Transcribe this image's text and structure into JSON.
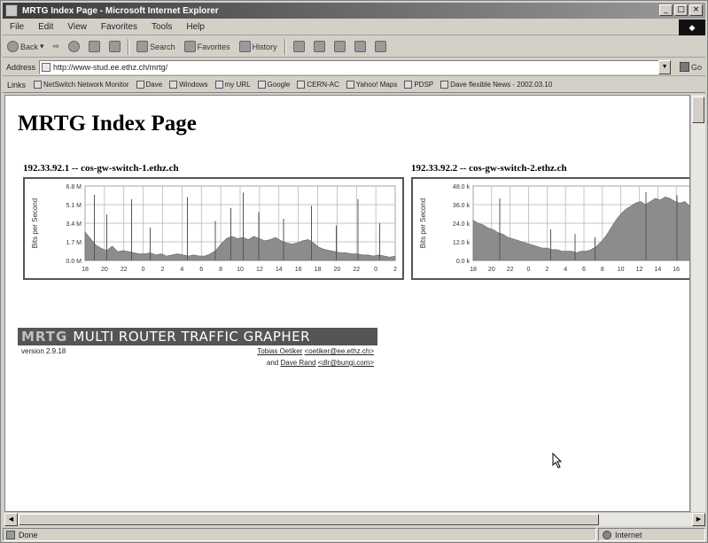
{
  "window": {
    "title": "MRTG Index Page - Microsoft Internet Explorer",
    "buttons": [
      "_",
      "□",
      "×"
    ]
  },
  "menu": {
    "items": [
      "File",
      "Edit",
      "View",
      "Favorites",
      "Tools",
      "Help"
    ]
  },
  "toolbar": {
    "back": "Back",
    "search": "Search",
    "favorites": "Favorites",
    "history": "History"
  },
  "address": {
    "label": "Address",
    "url": "http://www-stud.ee.ethz.ch/mrtg/",
    "go": "Go"
  },
  "links": {
    "label": "Links",
    "items": [
      "NetSwitch Network Monitor",
      "Dave",
      "Windows",
      "my URL",
      "Google",
      "CERN-AC",
      "Yahoo! Maps",
      "PDSP",
      "Dave flexible News - 2002.03.10"
    ]
  },
  "page": {
    "title": "MRTG Index Page"
  },
  "graphs": [
    {
      "caption": "192.33.92.1 -- cos-gw-switch-1.ethz.ch",
      "ylabel": "Bits per Second",
      "yticks": [
        "6.8 M",
        "5.1 M",
        "3.4 M",
        "1.7 M",
        "0.0 M"
      ],
      "ymax": 6.8,
      "xticks": [
        "18",
        "20",
        "22",
        "0",
        "2",
        "4",
        "6",
        "8",
        "10",
        "12",
        "14",
        "16",
        "18",
        "20",
        "22",
        "0",
        "2"
      ],
      "area": [
        2.6,
        2.0,
        1.4,
        1.1,
        0.9,
        1.3,
        0.8,
        0.9,
        0.8,
        0.7,
        0.6,
        0.6,
        0.7,
        0.5,
        0.6,
        0.4,
        0.5,
        0.6,
        0.5,
        0.4,
        0.5,
        0.4,
        0.4,
        0.6,
        0.9,
        1.5,
        2.0,
        2.2,
        2.0,
        2.1,
        1.9,
        2.2,
        2.0,
        1.8,
        1.9,
        2.1,
        1.8,
        1.6,
        1.5,
        1.6,
        1.8,
        1.9,
        1.6,
        1.2,
        1.0,
        0.9,
        0.8,
        0.7,
        0.7,
        0.6,
        0.6,
        0.5,
        0.5,
        0.4,
        0.5,
        0.4,
        0.3,
        0.4
      ],
      "spikes": [
        {
          "at": 0.03,
          "v": 6.0
        },
        {
          "at": 0.07,
          "v": 4.2
        },
        {
          "at": 0.15,
          "v": 5.6
        },
        {
          "at": 0.21,
          "v": 3.0
        },
        {
          "at": 0.33,
          "v": 5.8
        },
        {
          "at": 0.42,
          "v": 3.6
        },
        {
          "at": 0.47,
          "v": 4.8
        },
        {
          "at": 0.51,
          "v": 6.2
        },
        {
          "at": 0.56,
          "v": 4.4
        },
        {
          "at": 0.64,
          "v": 3.8
        },
        {
          "at": 0.73,
          "v": 5.0
        },
        {
          "at": 0.81,
          "v": 3.2
        },
        {
          "at": 0.88,
          "v": 5.6
        },
        {
          "at": 0.95,
          "v": 3.4
        }
      ]
    },
    {
      "caption": "192.33.92.2 -- cos-gw-switch-2.ethz.ch",
      "ylabel": "Bits per Second",
      "yticks": [
        "48.0 k",
        "36.0 k",
        "24.0 k",
        "12.0 k",
        "0.0 k"
      ],
      "ymax": 48.0,
      "xticks": [
        "18",
        "20",
        "22",
        "0",
        "2",
        "4",
        "6",
        "8",
        "10",
        "12",
        "14",
        "16",
        "18"
      ],
      "area": [
        26,
        24,
        23,
        21,
        20,
        18,
        17,
        15,
        14,
        13,
        12,
        11,
        10,
        9,
        8,
        8,
        7,
        7,
        6,
        6,
        6,
        5,
        6,
        6,
        7,
        9,
        12,
        16,
        21,
        26,
        30,
        33,
        35,
        37,
        38,
        36,
        38,
        40,
        39,
        41,
        40,
        38,
        37,
        38,
        35,
        30
      ],
      "spikes": [
        {
          "at": 0.12,
          "v": 40
        },
        {
          "at": 0.35,
          "v": 20
        },
        {
          "at": 0.46,
          "v": 17
        },
        {
          "at": 0.55,
          "v": 15
        },
        {
          "at": 0.78,
          "v": 44
        },
        {
          "at": 0.92,
          "v": 42
        }
      ]
    }
  ],
  "footer": {
    "logo_mark": "MRTG",
    "logo_text": "MULTI ROUTER TRAFFIC GRAPHER",
    "version": "version 2.9.18",
    "author1_name": "Tobias Oetiker",
    "author1_email": "<oetiker@ee.ethz.ch>",
    "and": "and",
    "author2_name": "Dave Rand",
    "author2_email": "<dlr@bungi.com>"
  },
  "status": {
    "text": "Done",
    "zone": "Internet"
  },
  "colors": {
    "graph_fill": "#8c8c8c",
    "graph_spike": "#555555",
    "graph_grid": "#b0b0b0"
  }
}
